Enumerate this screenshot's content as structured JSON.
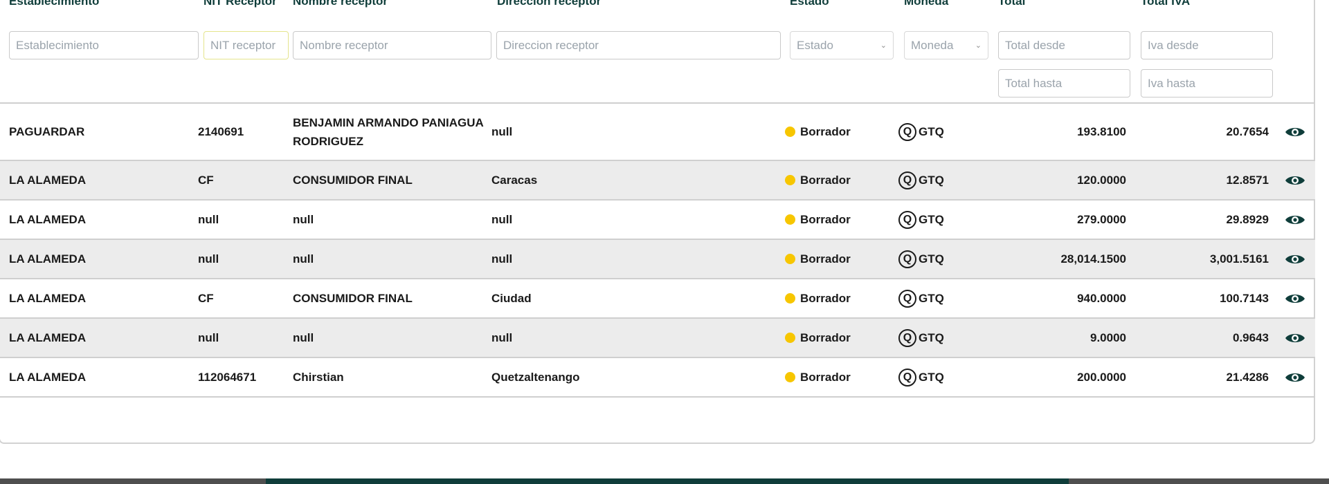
{
  "headers": {
    "establecimiento": "Establecimiento",
    "nit": "NIT Receptor",
    "nombre": "Nombre receptor",
    "direccion": "Direccion receptor",
    "estado": "Estado",
    "moneda": "Moneda",
    "total": "Total",
    "total_iva": "Total IVA"
  },
  "filters": {
    "establecimiento": "Establecimiento",
    "nit": "NIT receptor",
    "nombre": "Nombre receptor",
    "direccion": "Direccion receptor",
    "estado": "Estado",
    "moneda": "Moneda",
    "total_desde": "Total desde",
    "total_hasta": "Total hasta",
    "iva_desde": "Iva desde",
    "iva_hasta": "Iva hasta"
  },
  "currency_symbol": "Q",
  "status_color": "#f7c600",
  "rows": [
    {
      "establecimiento": "PAGUARDAR",
      "nit": "2140691",
      "nombre": "BENJAMIN ARMANDO PANIAGUA RODRIGUEZ",
      "direccion": "null",
      "estado": "Borrador",
      "moneda": "GTQ",
      "total": "193.8100",
      "iva": "20.7654"
    },
    {
      "establecimiento": "LA ALAMEDA",
      "nit": "CF",
      "nombre": "CONSUMIDOR FINAL",
      "direccion": "Caracas",
      "estado": "Borrador",
      "moneda": "GTQ",
      "total": "120.0000",
      "iva": "12.8571"
    },
    {
      "establecimiento": "LA ALAMEDA",
      "nit": "null",
      "nombre": "null",
      "direccion": "null",
      "estado": "Borrador",
      "moneda": "GTQ",
      "total": "279.0000",
      "iva": "29.8929"
    },
    {
      "establecimiento": "LA ALAMEDA",
      "nit": "null",
      "nombre": "null",
      "direccion": "null",
      "estado": "Borrador",
      "moneda": "GTQ",
      "total": "28,014.1500",
      "iva": "3,001.5161"
    },
    {
      "establecimiento": "LA ALAMEDA",
      "nit": "CF",
      "nombre": "CONSUMIDOR FINAL",
      "direccion": "Ciudad",
      "estado": "Borrador",
      "moneda": "GTQ",
      "total": "940.0000",
      "iva": "100.7143"
    },
    {
      "establecimiento": "LA ALAMEDA",
      "nit": "null",
      "nombre": "null",
      "direccion": "null",
      "estado": "Borrador",
      "moneda": "GTQ",
      "total": "9.0000",
      "iva": "0.9643"
    },
    {
      "establecimiento": "LA ALAMEDA",
      "nit": "112064671",
      "nombre": "Chirstian",
      "direccion": "Quetzaltenango",
      "estado": "Borrador",
      "moneda": "GTQ",
      "total": "200.0000",
      "iva": "21.4286"
    }
  ]
}
